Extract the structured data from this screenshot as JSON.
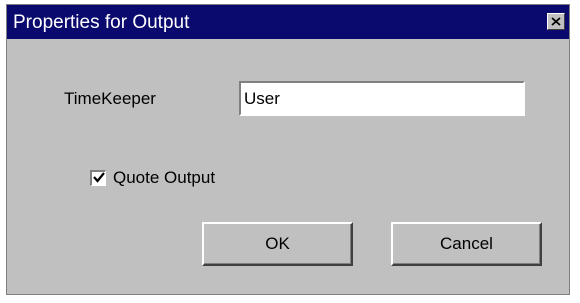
{
  "window": {
    "title": "Properties for Output",
    "close_icon": "close-icon"
  },
  "form": {
    "timekeeper_label": "TimeKeeper",
    "timekeeper_value": "User",
    "quote_output_label": "Quote Output",
    "quote_output_checked": true
  },
  "buttons": {
    "ok_label": "OK",
    "cancel_label": "Cancel"
  },
  "colors": {
    "titlebar": "#0a0a6e",
    "dialog_bg": "#c0c0c0"
  }
}
